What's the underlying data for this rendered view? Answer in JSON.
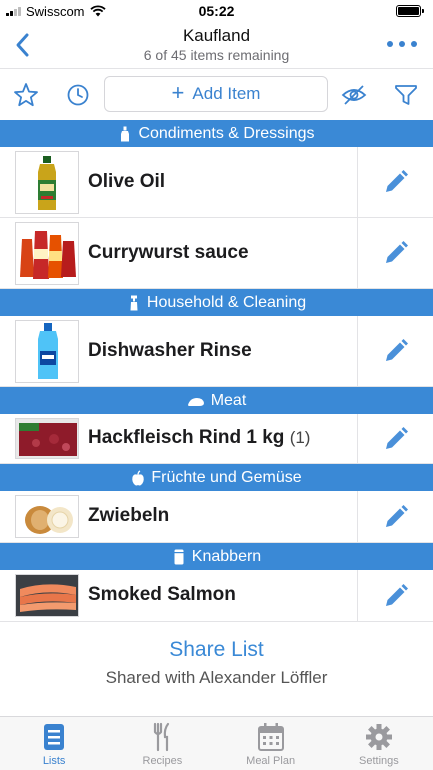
{
  "status_bar": {
    "carrier": "Swisscom",
    "time": "05:22"
  },
  "nav": {
    "title": "Kaufland",
    "subtitle": "6 of 45 items remaining"
  },
  "toolbar": {
    "add_item_label": "Add Item"
  },
  "sections": [
    {
      "title": "Condiments & Dressings",
      "icon": "bottle-icon",
      "items": [
        {
          "name": "Olive Oil",
          "qty": ""
        },
        {
          "name": "Currywurst sauce",
          "qty": ""
        }
      ]
    },
    {
      "title": "Household & Cleaning",
      "icon": "spray-bottle-icon",
      "items": [
        {
          "name": "Dishwasher Rinse",
          "qty": ""
        }
      ]
    },
    {
      "title": "Meat",
      "icon": "steak-icon",
      "items": [
        {
          "name": "Hackfleisch Rind 1 kg",
          "qty": "(1)"
        }
      ]
    },
    {
      "title": "Früchte und Gemüse",
      "icon": "apple-icon",
      "items": [
        {
          "name": "Zwiebeln",
          "qty": ""
        }
      ]
    },
    {
      "title": "Knabbern",
      "icon": "snack-can-icon",
      "items": [
        {
          "name": "Smoked Salmon",
          "qty": ""
        }
      ]
    }
  ],
  "share": {
    "title": "Share List",
    "subtitle": "Shared with Alexander Löffler"
  },
  "tabs": [
    {
      "label": "Lists",
      "active": true
    },
    {
      "label": "Recipes",
      "active": false
    },
    {
      "label": "Meal Plan",
      "active": false
    },
    {
      "label": "Settings",
      "active": false
    }
  ],
  "colors": {
    "accent": "#3a82cf",
    "section_header": "#3a89d6",
    "inactive_tab": "#9a9a9e"
  }
}
